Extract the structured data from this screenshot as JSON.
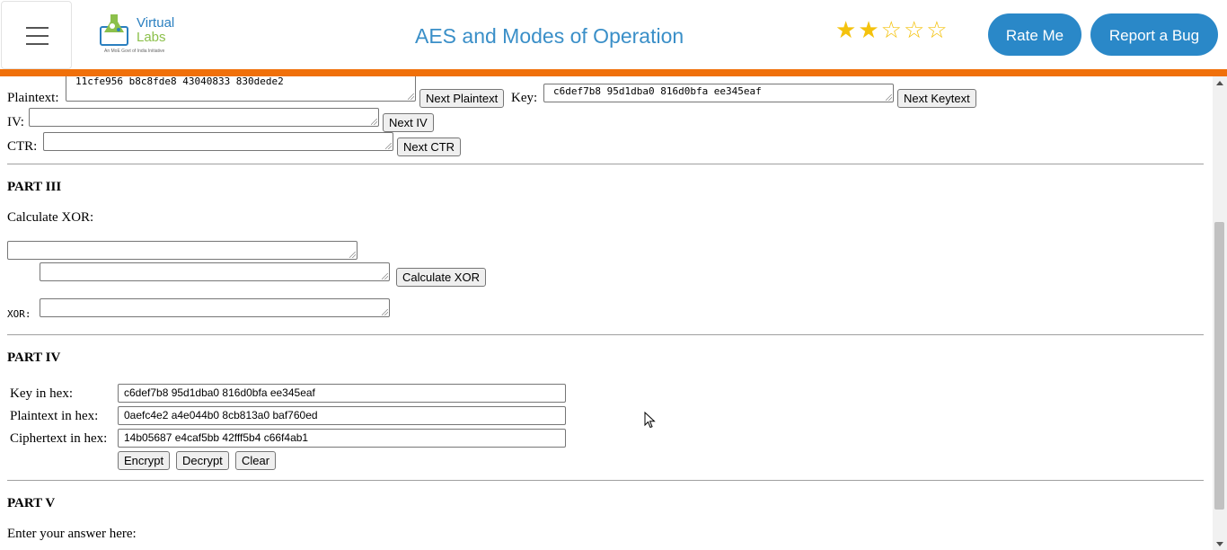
{
  "header": {
    "title": "AES and Modes of Operation",
    "logo_line1": "Virtual",
    "logo_line2": "Labs",
    "logo_tagline": "An MoE Govt of India Initiative",
    "rating_filled": 2,
    "rating_max": 5,
    "rate_label": "Rate Me",
    "bug_label": "Report a Bug",
    "accent_color": "#f0700a",
    "brand_color": "#2a88c8"
  },
  "part2": {
    "plaintext_label": "Plaintext:",
    "plaintext_value": "11cfe956 b8c8fde8 43040833 830dede2",
    "next_plaintext": "Next Plaintext",
    "key_label": "Key:",
    "key_value": "c6def7b8 95d1dba0 816d0bfa ee345eaf",
    "next_key": "Next Keytext",
    "iv_label": "IV:",
    "iv_value": "",
    "next_iv": "Next IV",
    "ctr_label": "CTR:",
    "ctr_value": "",
    "next_ctr": "Next CTR"
  },
  "part3": {
    "heading": "PART III",
    "subheading": "Calculate XOR:",
    "input1": "",
    "input2": "",
    "calc_button": "Calculate XOR",
    "xor_label": "XOR:",
    "xor_value": ""
  },
  "part4": {
    "heading": "PART IV",
    "key_label": "Key in hex:",
    "key_value": "c6def7b8 95d1dba0 816d0bfa ee345eaf",
    "plain_label": "Plaintext in hex:",
    "plain_value": "0aefc4e2 a4e044b0 8cb813a0 baf760ed",
    "cipher_label": "Ciphertext in hex:",
    "cipher_value": "14b05687 e4caf5bb 42fff5b4 c66f4ab1",
    "encrypt": "Encrypt",
    "decrypt": "Decrypt",
    "clear": "Clear"
  },
  "part5": {
    "heading": "PART V",
    "prompt": "Enter your answer here:"
  },
  "icons": {
    "menu": "hamburger-menu-icon",
    "star_filled": "star-filled-icon",
    "star_empty": "star-outline-icon",
    "cursor": "mouse-pointer-icon"
  }
}
